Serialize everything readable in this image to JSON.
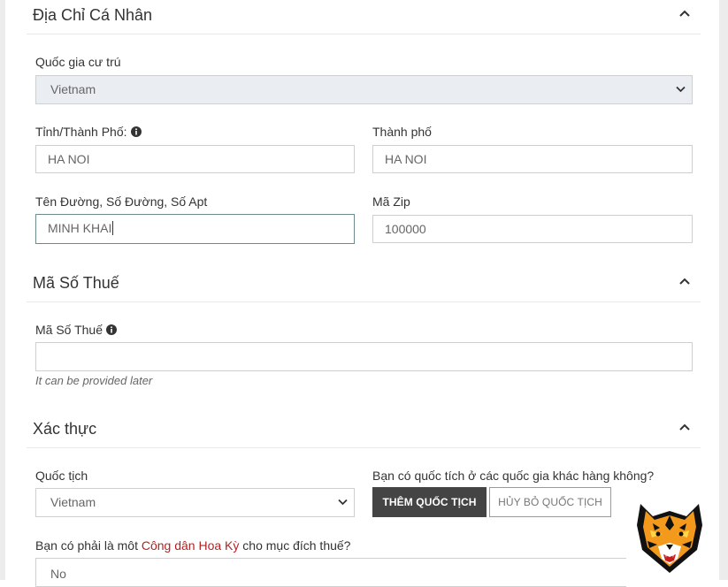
{
  "sections": {
    "address": {
      "title": "Địa Chỉ Cá Nhân",
      "country_label": "Quốc gia cư trú",
      "country_value": "Vietnam",
      "province_label": "Tỉnh/Thành Phố:",
      "province_value": "HA NOI",
      "city_label": "Thành phố",
      "city_value": "HA NOI",
      "street_label": "Tên Đường, Số Đường, Số Apt",
      "street_value": "MINH KHAI",
      "zip_label": "Mã Zip",
      "zip_value": "100000"
    },
    "tax": {
      "title": "Mã Số Thuế",
      "tax_label": "Mã Số Thuế",
      "tax_value": "",
      "hint": "It can be provided later"
    },
    "verification": {
      "title": "Xác thực",
      "nationality_label": "Quốc tịch",
      "nationality_value": "Vietnam",
      "other_citizenship_question": "Bạn có quốc tích ở các quốc gia khác hàng không?",
      "add_button": "THÊM QUỐC TỊCH",
      "cancel_button": "HỦY BỎ QUỐC TỊCH",
      "us_question_prefix": "Bạn có phải là môt ",
      "us_question_link": "Công dân Hoa Kỳ",
      "us_question_suffix": " cho mục đích thuế?",
      "us_value": "No"
    }
  },
  "icons": {
    "collapse": "chevron-up-icon",
    "info": "info-circle-icon",
    "select": "chevron-down-icon",
    "logo": "tiger-logo"
  },
  "colors": {
    "dark_button": "#444444",
    "link_red": "#b22222",
    "disabled_field": "#eaedf2"
  }
}
